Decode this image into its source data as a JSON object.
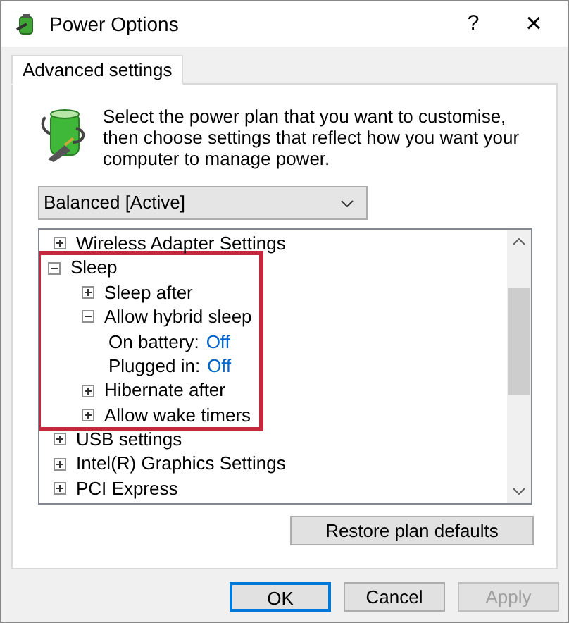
{
  "window": {
    "title": "Power Options",
    "help": "?",
    "close": "×"
  },
  "tabs": [
    {
      "label": "Advanced settings",
      "selected": true
    }
  ],
  "intro": "Select the power plan that you want to customise, then choose settings that reflect how you want your computer to manage power.",
  "plan_dropdown": {
    "value": "Balanced [Active]"
  },
  "tree": [
    {
      "label": "Wireless Adapter Settings",
      "expanded": false,
      "highlighted": false
    },
    {
      "label": "Sleep",
      "expanded": true,
      "highlighted": true,
      "children": [
        {
          "label": "Sleep after",
          "expanded": false,
          "highlighted": false
        },
        {
          "label": "Allow hybrid sleep",
          "expanded": true,
          "highlighted": false,
          "children": [
            {
              "label": "On battery:",
              "value": "Off"
            },
            {
              "label": "Plugged in:",
              "value": "Off"
            }
          ]
        },
        {
          "label": "Hibernate after",
          "expanded": false,
          "highlighted": false
        },
        {
          "label": "Allow wake timers",
          "expanded": false,
          "highlighted": false
        }
      ]
    },
    {
      "label": "USB settings",
      "expanded": false,
      "highlighted": false
    },
    {
      "label": "Intel(R) Graphics Settings",
      "expanded": false,
      "highlighted": false
    },
    {
      "label": "PCI Express",
      "expanded": false,
      "highlighted": false
    }
  ],
  "restore_button": "Restore plan defaults",
  "buttons": [
    {
      "label": "OK",
      "default": true,
      "disabled": false
    },
    {
      "label": "Cancel",
      "default": false,
      "disabled": false
    },
    {
      "label": "Apply",
      "default": false,
      "disabled": true
    }
  ]
}
